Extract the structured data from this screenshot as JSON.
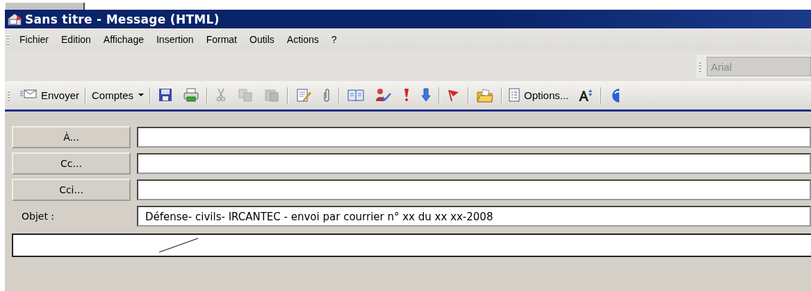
{
  "window": {
    "title": "Sans titre - Message (HTML)"
  },
  "menu": [
    "Fichier",
    "Edition",
    "Affichage",
    "Insertion",
    "Format",
    "Outils",
    "Actions",
    "?"
  ],
  "format_bar": {
    "font": "Arial"
  },
  "toolbar": [
    {
      "kind": "text",
      "label": "Envoyer"
    },
    {
      "kind": "sep"
    },
    {
      "kind": "dropdown",
      "label": "Comptes"
    },
    {
      "kind": "sep"
    },
    {
      "kind": "icon",
      "disabled": false
    },
    {
      "kind": "icon",
      "disabled": false
    },
    {
      "kind": "sep"
    },
    {
      "kind": "icon",
      "disabled": true
    },
    {
      "kind": "icon",
      "disabled": true
    },
    {
      "kind": "icon",
      "disabled": true
    },
    {
      "kind": "sep"
    },
    {
      "kind": "icon",
      "disabled": false
    },
    {
      "kind": "icon",
      "disabled": false
    },
    {
      "kind": "sep"
    },
    {
      "kind": "icon",
      "disabled": false
    },
    {
      "kind": "icon",
      "disabled": false
    },
    {
      "kind": "icon",
      "disabled": false
    },
    {
      "kind": "icon",
      "disabled": false
    },
    {
      "kind": "sep"
    },
    {
      "kind": "icon",
      "disabled": false
    },
    {
      "kind": "sep"
    },
    {
      "kind": "icon",
      "disabled": false
    },
    {
      "kind": "sep"
    },
    {
      "kind": "text",
      "label": "Options..."
    },
    {
      "kind": "icon",
      "disabled": false
    },
    {
      "kind": "sep"
    },
    {
      "kind": "icon",
      "disabled": false
    }
  ],
  "fields": [
    {
      "kind": "button",
      "label": "À..."
    },
    {
      "kind": "button",
      "label": "Cc..."
    },
    {
      "kind": "button",
      "label": "Cci..."
    },
    {
      "kind": "label",
      "label": "Objet :",
      "value": "Défense- civils- IRCANTEC - envoi par courrier n° xx du xx xx-2008"
    }
  ]
}
